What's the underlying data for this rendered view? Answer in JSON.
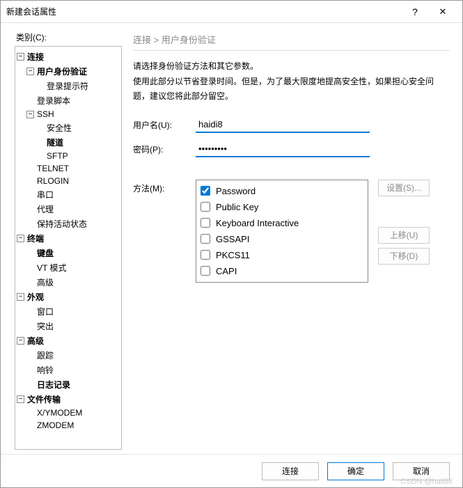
{
  "window": {
    "title": "新建会话属性",
    "help": "?",
    "close": "✕"
  },
  "category_label": "类别(C):",
  "tree": {
    "connection": "连接",
    "user_auth": "用户身份验证",
    "login_prompt": "登录提示符",
    "login_script": "登录脚本",
    "ssh": "SSH",
    "security": "安全性",
    "tunnel": "隧道",
    "sftp": "SFTP",
    "telnet": "TELNET",
    "rlogin": "RLOGIN",
    "serial": "串口",
    "proxy": "代理",
    "keepalive": "保持活动状态",
    "terminal": "终端",
    "keyboard": "键盘",
    "vtmode": "VT 模式",
    "advanced_t": "高级",
    "appearance": "外观",
    "window": "窗口",
    "popout": "突出",
    "advanced": "高级",
    "trace": "跟踪",
    "bell": "响铃",
    "logging": "日志记录",
    "filetransfer": "文件传输",
    "xymodem": "X/YMODEM",
    "zmodem": "ZMODEM"
  },
  "breadcrumb": "连接  >  用户身份验证",
  "instr1": "请选择身份验证方法和其它参数。",
  "instr2": "使用此部分以节省登录时间。但是，为了最大限度地提高安全性，如果担心安全问题，建议您将此部分留空。",
  "form": {
    "username_label": "用户名(U):",
    "username": "haidi8",
    "password_label": "密码(P):",
    "password": "•••••••••",
    "method_label": "方法(M):"
  },
  "methods": [
    {
      "label": "Password",
      "checked": true
    },
    {
      "label": "Public Key",
      "checked": false
    },
    {
      "label": "Keyboard Interactive",
      "checked": false
    },
    {
      "label": "GSSAPI",
      "checked": false
    },
    {
      "label": "PKCS11",
      "checked": false
    },
    {
      "label": "CAPI",
      "checked": false
    }
  ],
  "buttons": {
    "settings": "设置(S)...",
    "moveup": "上移(U)",
    "movedown": "下移(D)",
    "connect": "连接",
    "ok": "确定",
    "cancel": "取消"
  },
  "watermark": "CSDN @haidi8"
}
